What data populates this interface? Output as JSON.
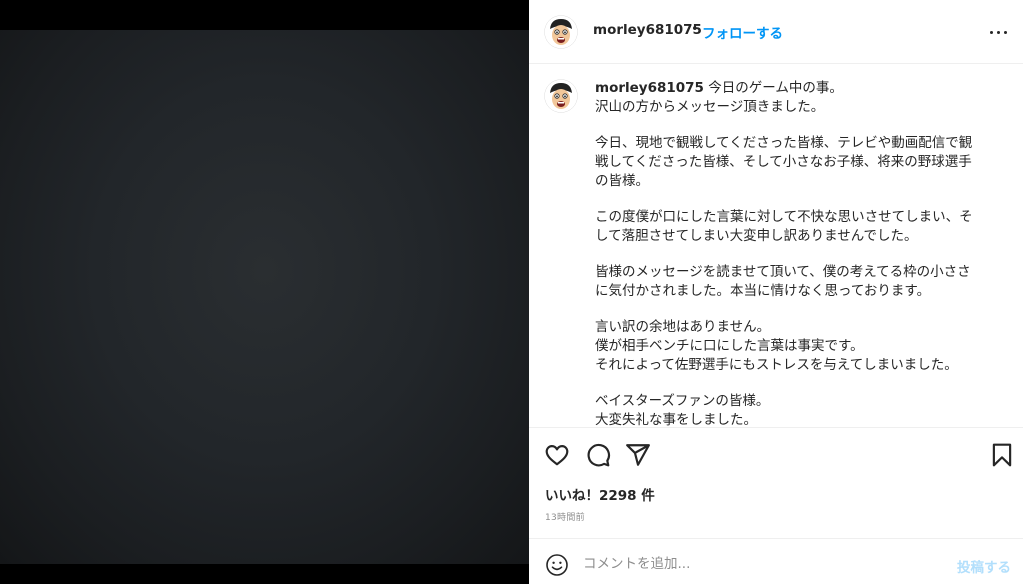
{
  "header": {
    "username": "morley681075",
    "separator": "•",
    "follow_label": "フォローする",
    "more_icon": "more-horizontal-icon"
  },
  "caption": {
    "username": "morley681075",
    "paragraphs": [
      "今日のゲーム中の事。\n沢山の方からメッセージ頂きました。",
      "今日、現地で観戦してくださった皆様、テレビや動画配信で観\n戦してくださった皆様、そして小さなお子様、将来の野球選手\nの皆様。",
      "この度僕が口にした言葉に対して不快な思いさせてしまい、そ\nして落胆させてしまい大変申し訳ありませんでした。",
      "皆様のメッセージを読ませて頂いて、僕の考えてる枠の小ささ\nに気付かされました。本当に情けなく思っております。",
      "言い訳の余地はありません。\n僕が相手ベンチに口にした言葉は事実です。\nそれによって佐野選手にもストレスを与えてしまいました。",
      "ベイスターズファンの皆様。\n大変失礼な事をしました。"
    ]
  },
  "actions": {
    "icons": [
      "heart-icon",
      "comment-icon",
      "share-icon",
      "bookmark-icon"
    ],
    "likes_text": "いいね！2298 件",
    "time_text": "13時間前"
  },
  "comment": {
    "placeholder": "コメントを追加...",
    "post_label": "投稿する",
    "emoji_icon": "emoji-icon"
  },
  "colors": {
    "accent": "#0095f6",
    "post_disabled": "#b2dffc",
    "text": "#262626",
    "secondary_text": "#8e8e8e"
  }
}
